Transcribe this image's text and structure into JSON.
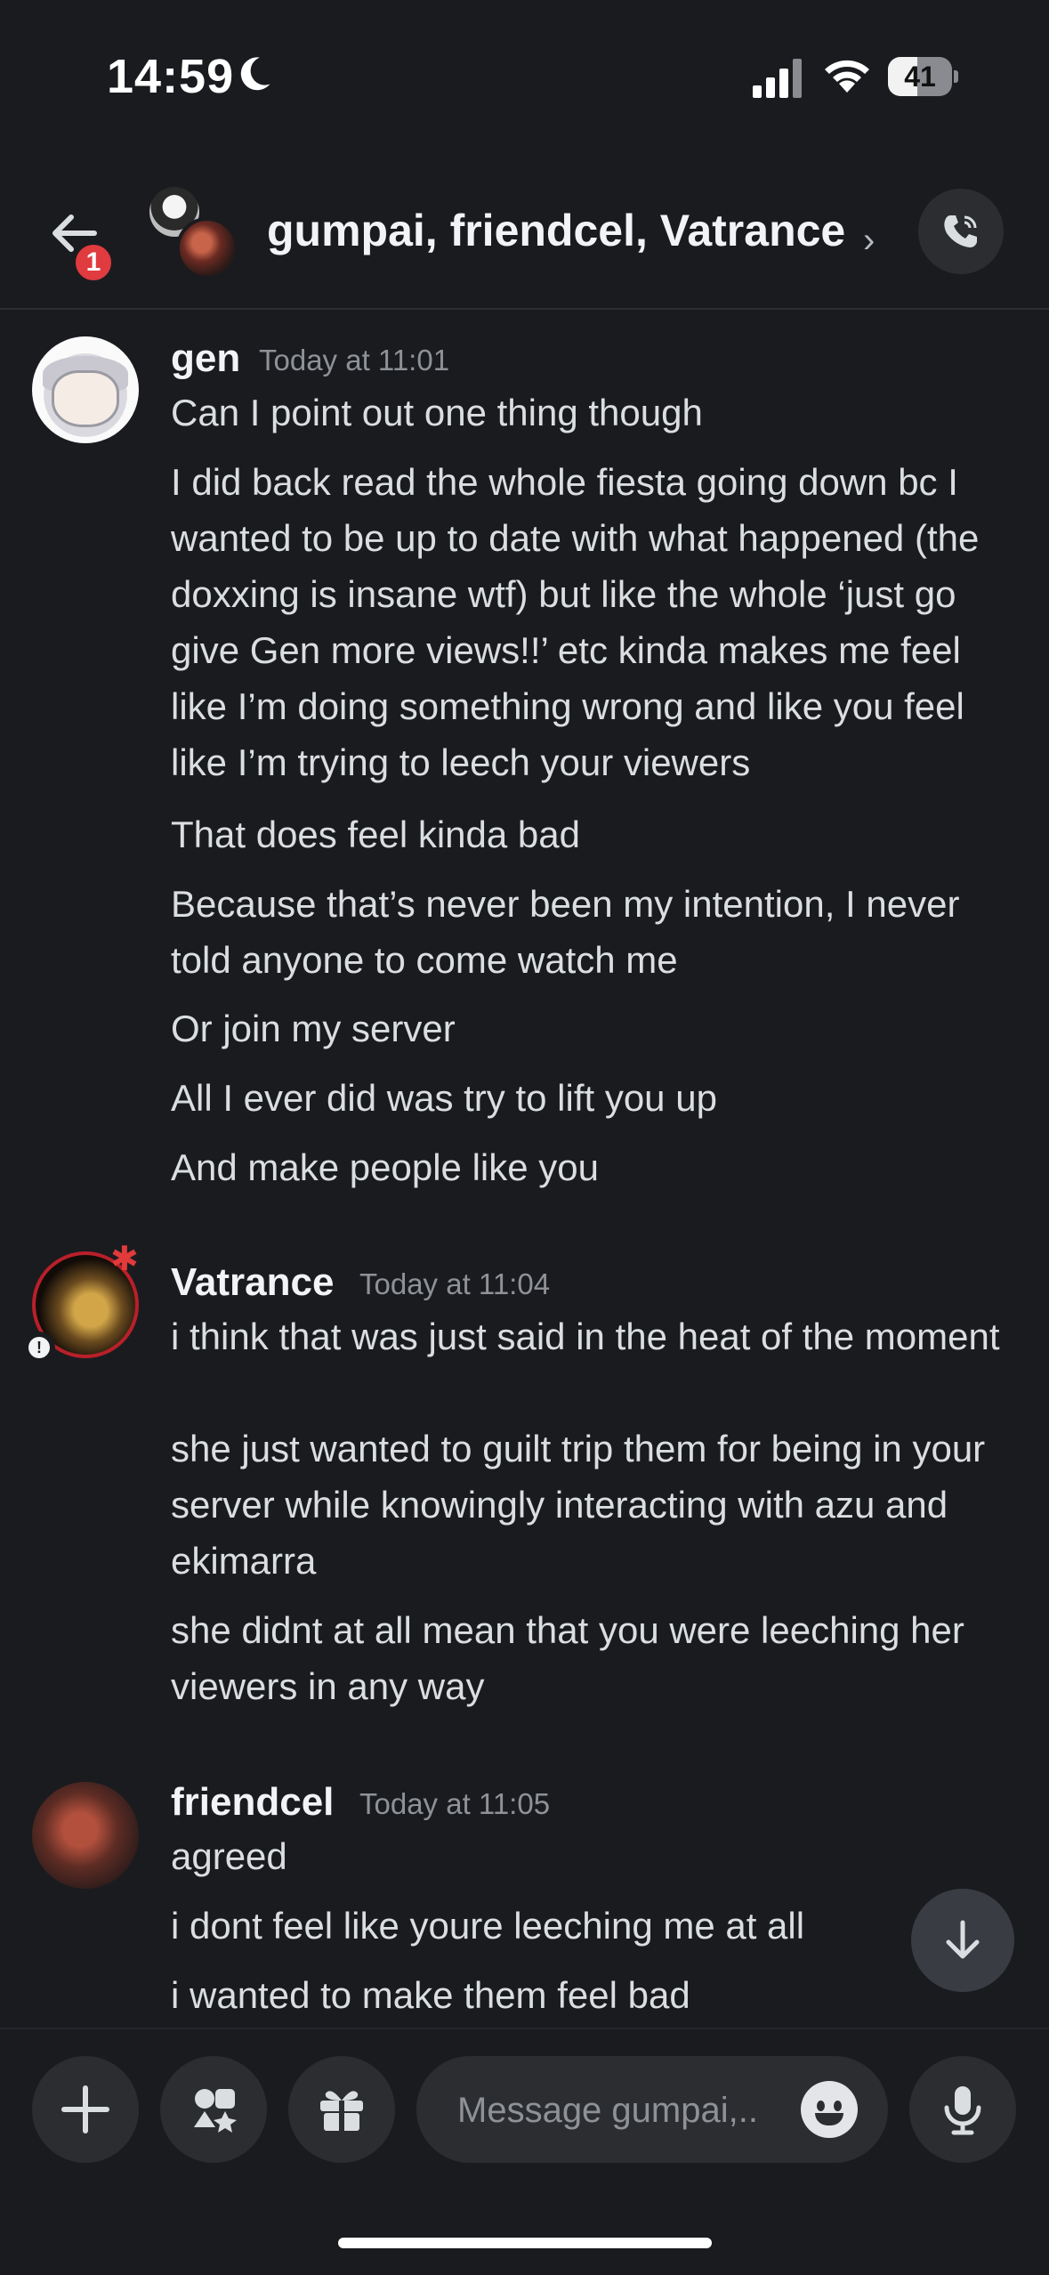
{
  "status_bar": {
    "time": "14:59",
    "battery": "41",
    "battery_fraction": 0.41
  },
  "header": {
    "back_badge": "1",
    "title": "gumpai, friendcel, Vatrance",
    "chevron": "›"
  },
  "messages": [
    {
      "author": "gen",
      "timestamp": "Today at 11:01",
      "lines": [
        "Can I point out one thing though",
        "I did back read the whole fiesta going down bc I wanted to be up to date with what happened (the doxxing is insane wtf) but like the whole ‘just go give Gen more views!!’ etc kinda makes me feel like I’m doing something wrong and like you feel like I’m trying to leech your viewers",
        "That does feel kinda bad",
        "Because that’s never been my intention, I never told anyone to come watch me",
        "Or join my server",
        "All I ever did was try to lift you up",
        "And make people like you"
      ]
    },
    {
      "author": "Vatrance",
      "timestamp": "Today at 11:04",
      "lines": [
        "i think that was just said in the heat of the moment",
        "she just wanted to guilt trip them for being in your server while knowingly interacting with azu and ekimarra",
        "she didnt at all mean that you were leeching her viewers in any way"
      ]
    },
    {
      "author": "friendcel",
      "timestamp": "Today at 11:05",
      "lines": [
        "agreed",
        "i dont feel like youre leeching me at all",
        "i wanted to make them feel bad"
      ]
    }
  ],
  "composer": {
    "placeholder": "Message gumpai,.."
  },
  "icons": {
    "back": "arrow-left-icon",
    "call": "phone-call-icon",
    "scroll_down": "arrow-down-icon",
    "attach": "plus-icon",
    "apps": "apps-icon",
    "gift": "gift-icon",
    "emoji": "emoji-icon",
    "mic": "microphone-icon"
  },
  "colors": {
    "background": "#1a1b1f",
    "badge": "#e03b3f",
    "text": "#dbdee1",
    "timestamp": "#8e9297"
  }
}
